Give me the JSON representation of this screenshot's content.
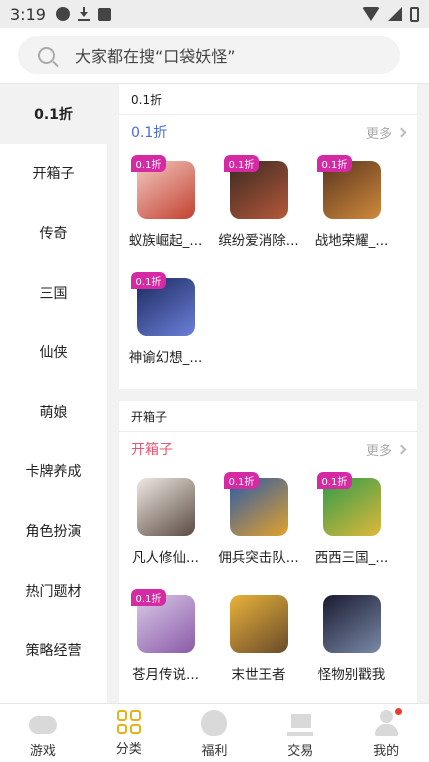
{
  "status_bar": {
    "time": "3:19"
  },
  "search": {
    "placeholder": "大家都在搜“口袋妖怪”"
  },
  "sidebar": {
    "items": [
      {
        "label": "0.1折",
        "active": true
      },
      {
        "label": "开箱子"
      },
      {
        "label": "传奇"
      },
      {
        "label": "三国"
      },
      {
        "label": "仙侠"
      },
      {
        "label": "萌娘"
      },
      {
        "label": "卡牌养成"
      },
      {
        "label": "角色扮演"
      },
      {
        "label": "热门题材"
      },
      {
        "label": "策略经营"
      }
    ]
  },
  "sections": [
    {
      "header": "0.1折",
      "category": "0.1折",
      "category_color": "#4a6cd4",
      "more": "更多",
      "games": [
        {
          "name": "蚁族崛起_...",
          "badge": "0.1折",
          "colors": [
            "#f3c9c2",
            "#c2412f"
          ]
        },
        {
          "name": "缤纷爱消除...",
          "badge": "0.1折",
          "colors": [
            "#3b2a22",
            "#b5583a"
          ]
        },
        {
          "name": "战地荣耀_...",
          "badge": "0.1折",
          "colors": [
            "#5a3520",
            "#d08a3a"
          ]
        },
        {
          "name": "神谕幻想_...",
          "badge": "0.1折",
          "colors": [
            "#1c2a60",
            "#6c7fd9"
          ]
        }
      ]
    },
    {
      "header": "开箱子",
      "category": "开箱子",
      "category_color": "#e8566f",
      "more": "更多",
      "games": [
        {
          "name": "凡人修仙...",
          "badge": "",
          "colors": [
            "#efe9e2",
            "#5a4a42"
          ]
        },
        {
          "name": "佣兵突击队...",
          "badge": "0.1折",
          "colors": [
            "#2c5aa8",
            "#e3a22a"
          ]
        },
        {
          "name": "西西三国_...",
          "badge": "0.1折",
          "colors": [
            "#2f9c4a",
            "#e0b83a"
          ]
        },
        {
          "name": "苍月传说...",
          "badge": "0.1折",
          "colors": [
            "#d9c9e8",
            "#8a5aa8"
          ]
        },
        {
          "name": "末世王者",
          "badge": "",
          "colors": [
            "#e8b33a",
            "#6a4a2a"
          ]
        },
        {
          "name": "怪物别戳我",
          "badge": "",
          "colors": [
            "#1a1a30",
            "#7a8aa8"
          ]
        }
      ]
    }
  ],
  "bottom_nav": {
    "items": [
      {
        "label": "游戏",
        "icon": "gamepad-icon"
      },
      {
        "label": "分类",
        "icon": "category-grid-icon",
        "active": true
      },
      {
        "label": "福利",
        "icon": "gift-bag-icon"
      },
      {
        "label": "交易",
        "icon": "cart-icon"
      },
      {
        "label": "我的",
        "icon": "user-icon"
      }
    ]
  }
}
